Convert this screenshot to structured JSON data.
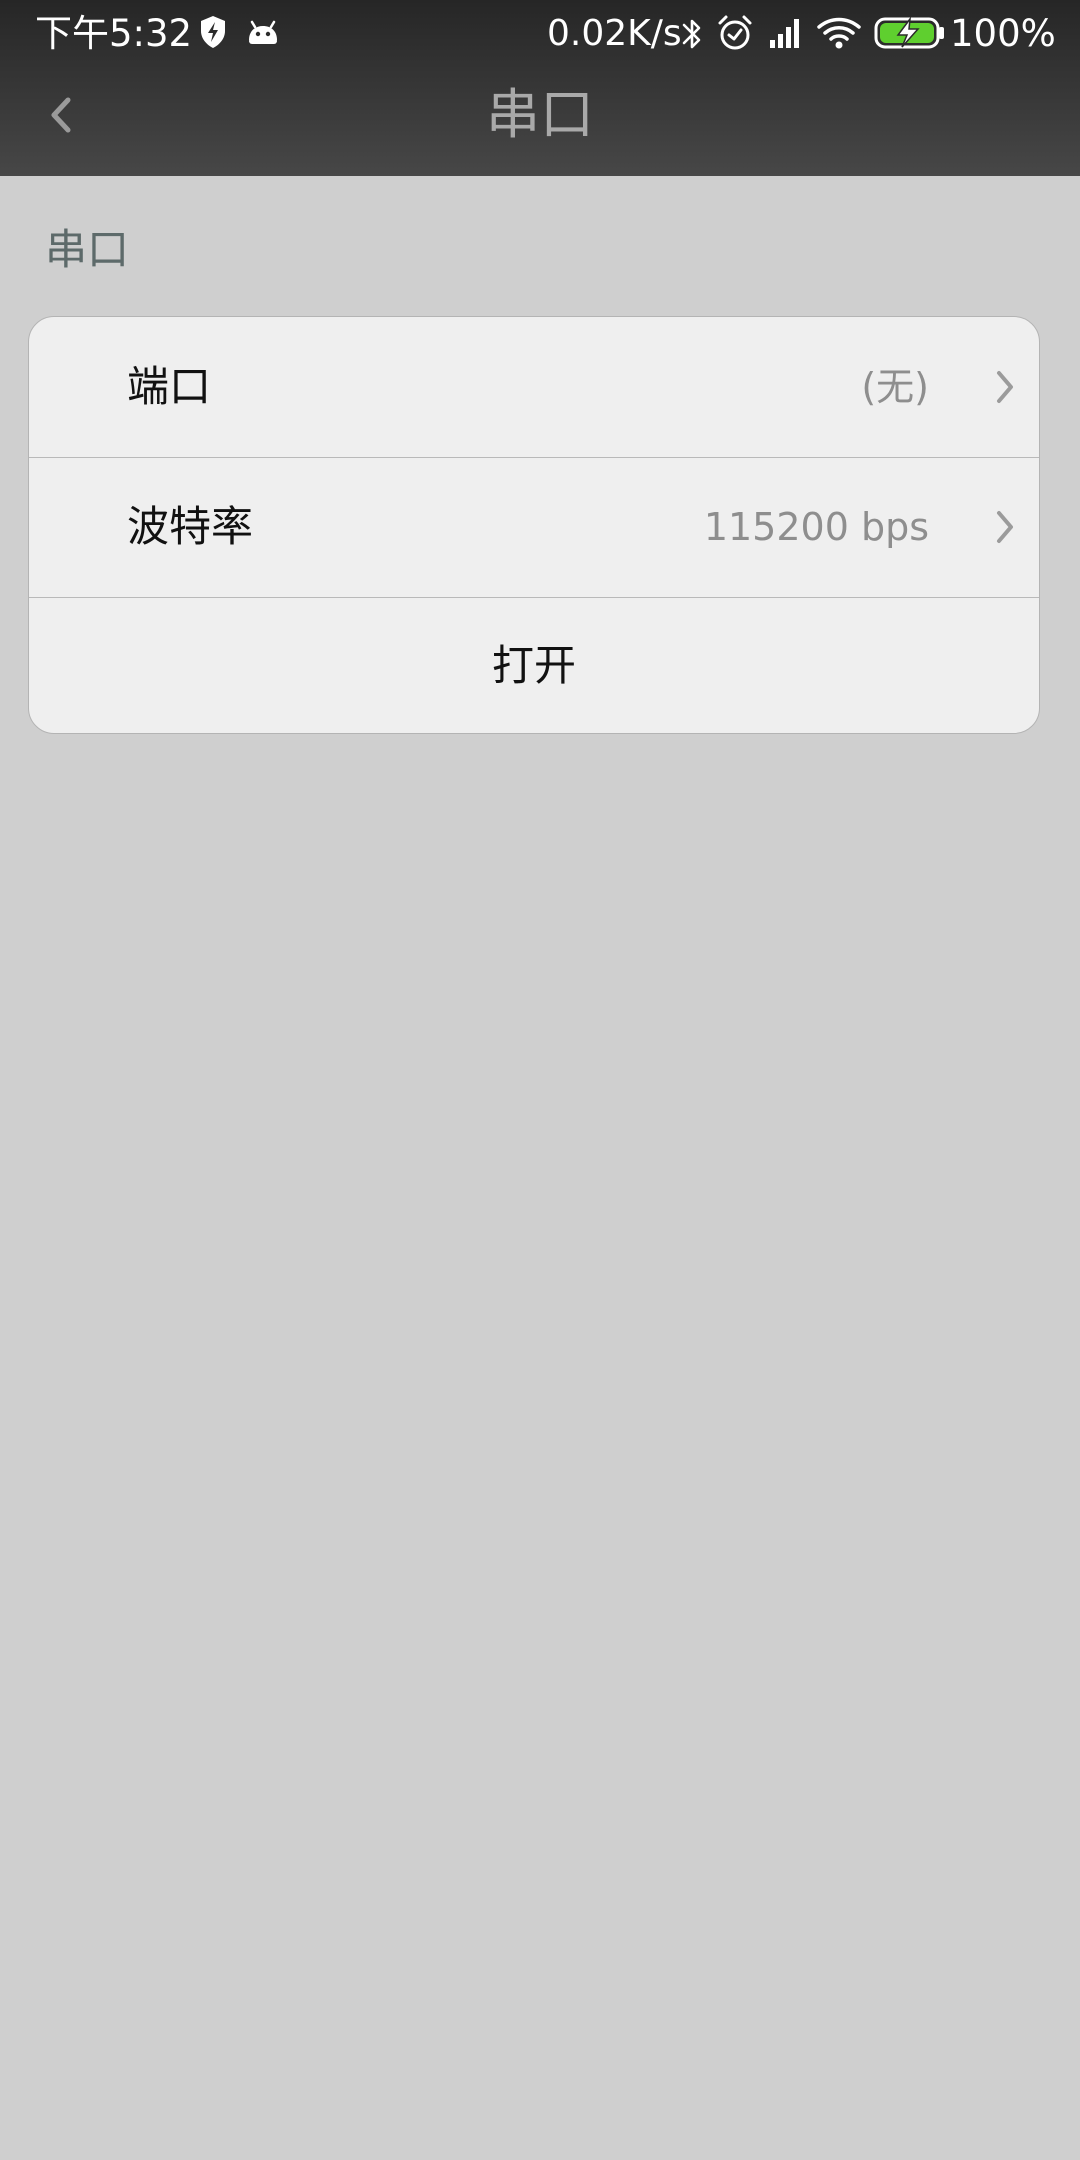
{
  "status_bar": {
    "time": "下午5:32",
    "net_speed": "0.02K/s",
    "battery": "100%",
    "icons": [
      "shield-bolt-icon",
      "android-icon",
      "bluetooth-icon",
      "alarm-icon",
      "signal-icon",
      "wifi-icon",
      "battery-charging-icon"
    ],
    "battery_fill_color": "#5fcf2f"
  },
  "header": {
    "title": "串口",
    "back_icon": "chevron-left-icon"
  },
  "section": {
    "title": "串口"
  },
  "settings": {
    "rows": [
      {
        "label": "端口",
        "value": "(无)",
        "icon": "chevron-right-icon"
      },
      {
        "label": "波特率",
        "value": "115200 bps",
        "icon": "chevron-right-icon"
      }
    ],
    "action_label": "打开"
  },
  "colors": {
    "background": "#cfcfcf",
    "card": "#efefef",
    "header_gradient_top": "#262626",
    "header_gradient_bottom": "#474747",
    "section_text": "#5d6a6a",
    "value_text": "#8e8e8e"
  }
}
